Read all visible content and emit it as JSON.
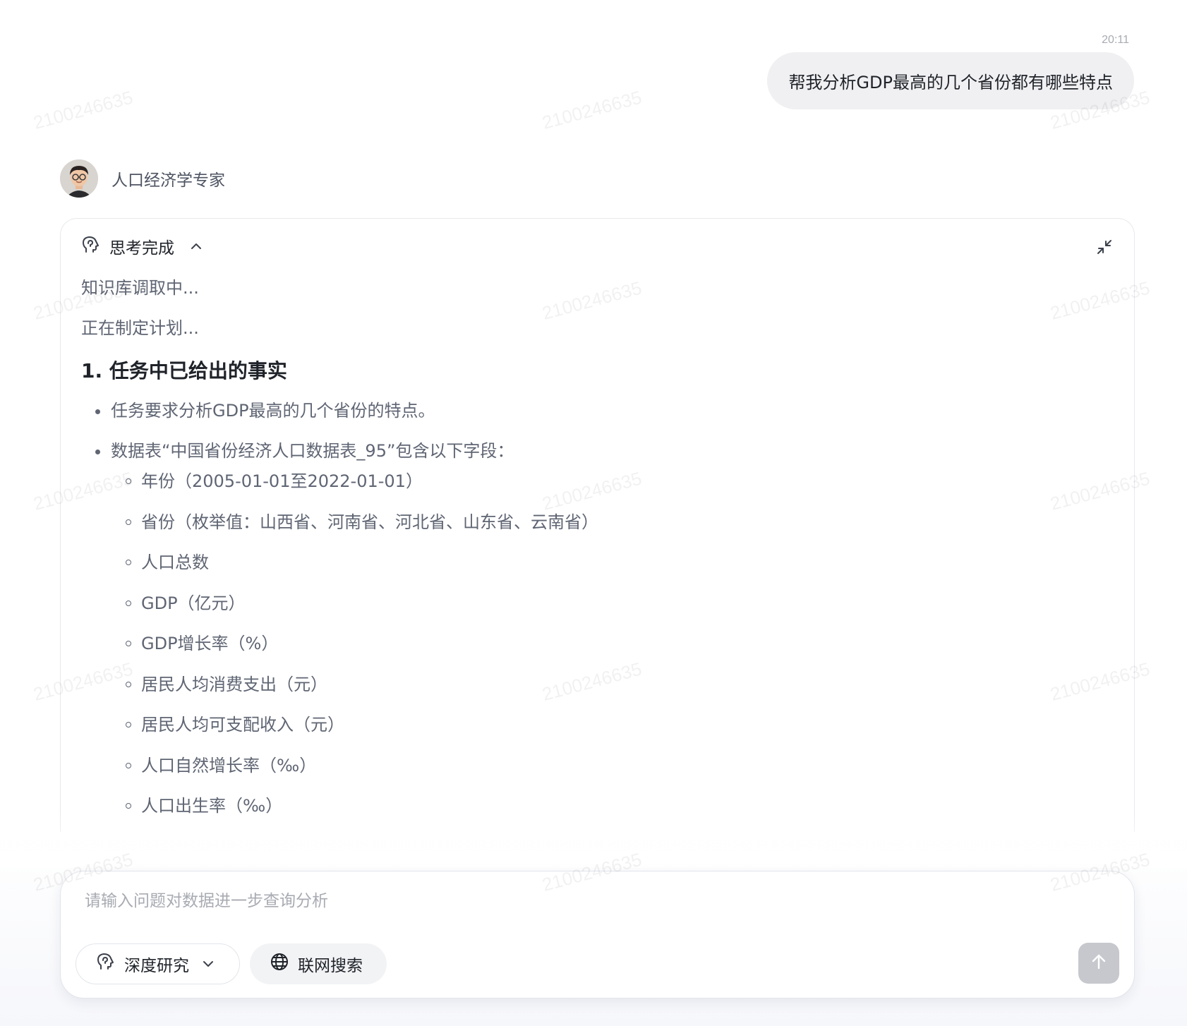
{
  "conversation": {
    "user_message": {
      "time": "20:11",
      "text": "帮我分析GDP最高的几个省份都有哪些特点"
    },
    "assistant": {
      "name": "人口经济学专家",
      "thinking": {
        "status_title": "思考完成",
        "steps": [
          "知识库调取中...",
          "正在制定计划..."
        ],
        "section_heading": "1. 任务中已给出的事实",
        "bullets": [
          "任务要求分析GDP最高的几个省份的特点。",
          "数据表“中国省份经济人口数据表_95”包含以下字段："
        ],
        "fields": [
          "年份（2005-01-01至2022-01-01）",
          "省份（枚举值：山西省、河南省、河北省、山东省、云南省）",
          "人口总数",
          "GDP（亿元）",
          "GDP增长率（%）",
          "居民人均消费支出（元）",
          "居民人均可支配收入（元）",
          "人口自然增长率（‰）",
          "人口出生率（‰）"
        ]
      }
    }
  },
  "composer": {
    "placeholder": "请输入问题对数据进一步查询分析",
    "deep_research_label": "深度研究",
    "web_search_label": "联网搜索"
  },
  "watermark": "2100246635",
  "icons": {
    "thinking": "brain-head-icon",
    "collapse": "collapse-arrows-icon",
    "chevron_up": "chevron-up-icon",
    "chevron_down": "chevron-down-icon",
    "globe": "globe-icon",
    "send": "arrow-up-icon"
  },
  "colors": {
    "user_bubble": "#f0f0f2",
    "body_text": "#5f6573",
    "send_disabled": "#c6c8cd"
  }
}
